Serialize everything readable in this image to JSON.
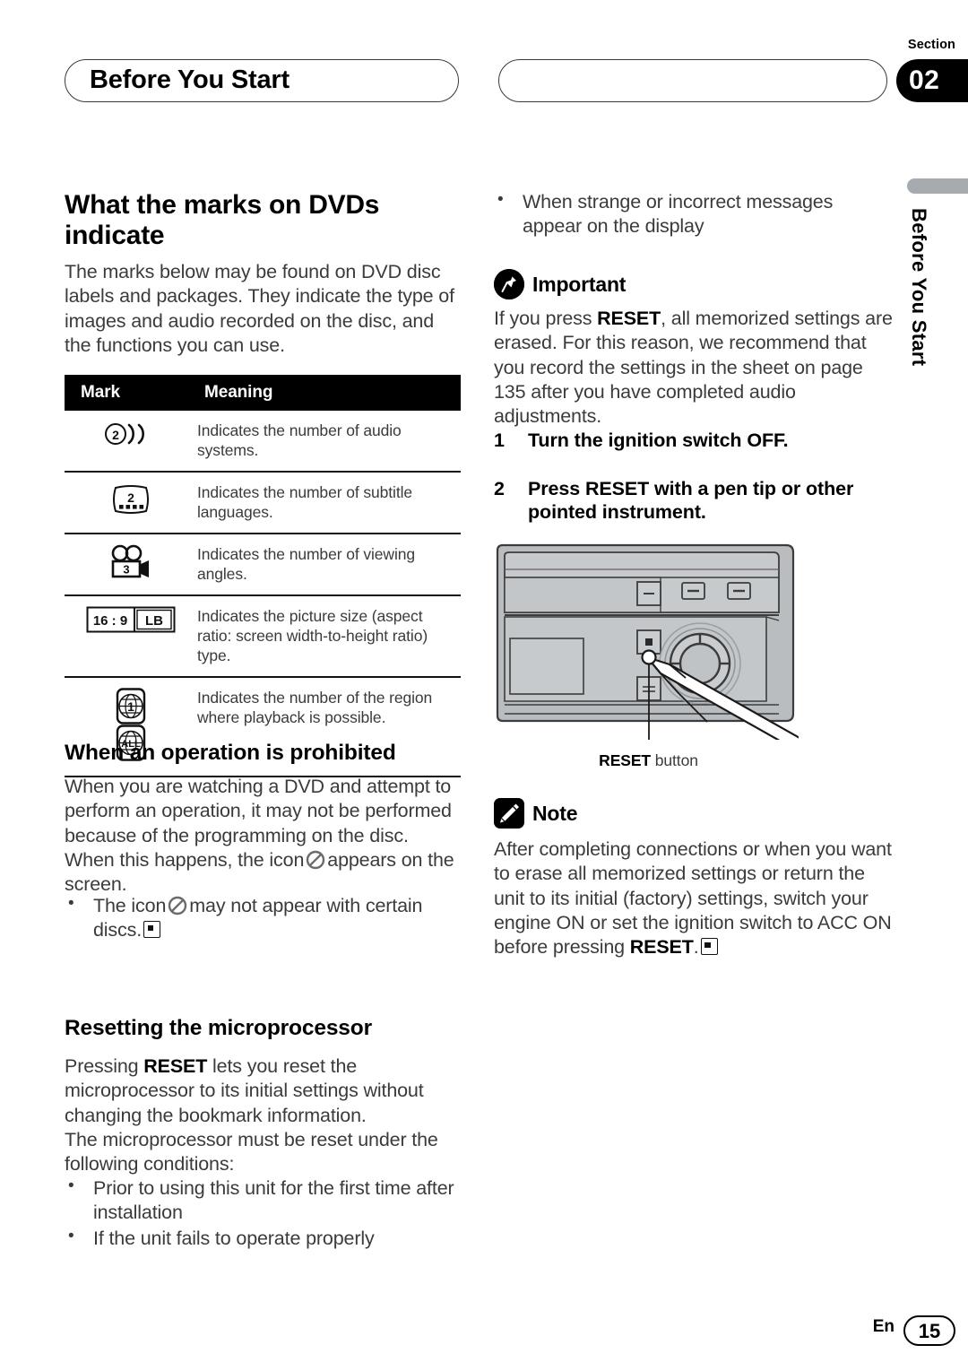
{
  "header": {
    "chapter_title": "Before You Start",
    "section_label": "Section",
    "section_number": "02",
    "side_tab_text": "Before You Start"
  },
  "left_column": {
    "heading_marks": "What the marks on DVDs indicate",
    "intro_paragraph": "The marks below may be found on DVD disc labels and packages. They indicate the type of images and audio recorded on the disc, and the functions you can use.",
    "table": {
      "columns": [
        "Mark",
        "Meaning"
      ],
      "rows": [
        {
          "icon": "audio-systems-icon",
          "icon_value": "2",
          "meaning": "Indicates the number of audio systems."
        },
        {
          "icon": "subtitle-languages-icon",
          "icon_value": "2",
          "meaning": "Indicates the number of subtitle languages."
        },
        {
          "icon": "viewing-angles-icon",
          "icon_value": "3",
          "meaning": "Indicates the number of viewing angles."
        },
        {
          "icon": "aspect-ratio-icon",
          "icon_value": "16 : 9",
          "icon_value2": "LB",
          "meaning": "Indicates the picture size (aspect ratio: screen width-to-height ratio) type."
        },
        {
          "icon": "region-code-icon",
          "icon_value": "1",
          "icon_value2": "ALL",
          "meaning": "Indicates the number of the region where playback is possible."
        }
      ]
    },
    "heading_prohibited": "When an operation is prohibited",
    "prohibited_para_1": "When you are watching a DVD and attempt to perform an operation, it may not be performed because of the programming on the disc. When this happens, the icon",
    "prohibited_para_2": "appears on the screen.",
    "prohibited_bullet_1": "The icon",
    "prohibited_bullet_2": "may not appear with certain discs.",
    "heading_resetting": "Resetting the microprocessor",
    "reset_para_1_a": "Pressing",
    "reset_para_1_b": "RESET",
    "reset_para_1_c": "lets you reset the microprocessor to its initial settings without changing the bookmark information.",
    "reset_para_2": "The microprocessor must be reset under the following conditions:",
    "reset_bullets": [
      "Prior to using this unit for the first time after installation",
      "If the unit fails to operate properly"
    ]
  },
  "right_column": {
    "bullet_continued": "When strange or incorrect messages appear on the display",
    "important_label": "Important",
    "important_para_a": "If you press",
    "important_para_b": "RESET",
    "important_para_c": ", all memorized settings are erased. For this reason, we recommend that you record the settings in the sheet on page 135 after you have completed audio adjustments.",
    "steps": [
      {
        "num": "1",
        "text": "Turn the ignition switch OFF."
      },
      {
        "num": "2",
        "text": "Press RESET with a pen tip or other pointed instrument."
      }
    ],
    "illustration_caption_bold": "RESET",
    "illustration_caption_rest": " button",
    "note_label": "Note",
    "note_para_a": "After completing connections or when you want to erase all memorized settings or return the unit to its initial (factory) settings, switch your engine ON or set the ignition switch to ACC ON before pressing",
    "note_para_b": "RESET",
    "note_para_c": "."
  },
  "footer": {
    "language": "En",
    "page_number": "15"
  },
  "colors": {
    "text_body": "#3b3b3b",
    "text_heading": "#000000",
    "table_header_bg": "#000000",
    "side_tab_bar": "#a7abaf",
    "illustration_body": "#b9bdc0",
    "illustration_panel": "#c9cdd0"
  }
}
